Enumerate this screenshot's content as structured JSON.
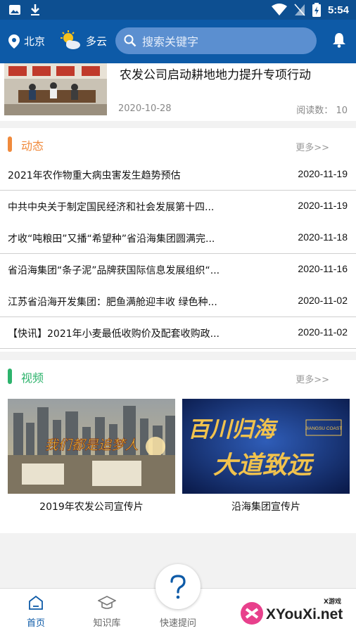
{
  "status": {
    "time": "5:54"
  },
  "header": {
    "city": "北京",
    "weather": "多云",
    "search_placeholder": "搜索关键字"
  },
  "featured": {
    "title": "农发公司启动耕地地力提升专项行动",
    "date": "2020-10-28",
    "reads_label": "阅读数：",
    "reads": "10"
  },
  "news": {
    "title": "动态",
    "more": "更多>>",
    "items": [
      {
        "title": "2021年农作物重大病虫害发生趋势预估",
        "date": "2020-11-19"
      },
      {
        "title": "中共中央关于制定国民经济和社会发展第十四...",
        "date": "2020-11-19"
      },
      {
        "title": "才收“吨粮田”又播“希望种”省沿海集团圆满完...",
        "date": "2020-11-18"
      },
      {
        "title": "省沿海集团“条子泥”品牌获国际信息发展组织“...",
        "date": "2020-11-16"
      },
      {
        "title": "江苏省沿海开发集团：肥鱼满舱迎丰收 绿色种...",
        "date": "2020-11-02"
      },
      {
        "title": "【快讯】2021年小麦最低收购价及配套收购政...",
        "date": "2020-11-02"
      }
    ]
  },
  "video": {
    "title": "视频",
    "more": "更多>>",
    "items": [
      {
        "label": "2019年农发公司宣传片",
        "overlay": "我们都是追梦人"
      },
      {
        "label": "沿海集团宣传片",
        "overlay_line1": "百川归海",
        "overlay_line2": "大道致远",
        "badge": "JIANGSU COAST"
      }
    ]
  },
  "tabs": [
    {
      "label": "首页",
      "active": true
    },
    {
      "label": "知识库",
      "active": false
    },
    {
      "label": "快速提问",
      "active": false
    }
  ],
  "watermark": {
    "text": "XYouXi.net",
    "small": "X游戏"
  },
  "colors": {
    "header": "#0d5aa7",
    "statusbar": "#0d4f91",
    "news_accent": "#f08a3c",
    "video_accent": "#2db36c",
    "active_tab": "#0d5aa7"
  }
}
